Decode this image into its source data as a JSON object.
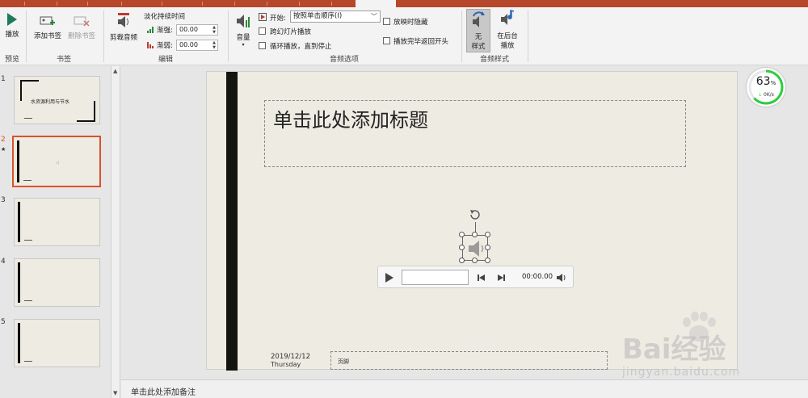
{
  "ribbon": {
    "preview": {
      "play_label": "播放",
      "group_label": "预览"
    },
    "bookmarks": {
      "add_label": "添加书签",
      "remove_label": "删除书签",
      "group_label": "书签"
    },
    "editing": {
      "trim_label": "剪裁音频",
      "fade_title": "淡化持续时间",
      "fade_in_label": "渐强:",
      "fade_in_value": "00.00",
      "fade_out_label": "渐弱:",
      "fade_out_value": "00.00",
      "group_label": "编辑"
    },
    "audio_options": {
      "volume_label": "音量",
      "start_label": "开始:",
      "start_value": "按照单击顺序(I)",
      "cross_slides_label": "跨幻灯片播放",
      "loop_label": "循环播放，直到停止",
      "hide_label": "放映时隐藏",
      "rewind_label": "播放完毕返回开头",
      "group_label": "音频选项"
    },
    "audio_styles": {
      "no_style_label_1": "无",
      "no_style_label_2": "样式",
      "bg_play_label_1": "在后台",
      "bg_play_label_2": "播放",
      "group_label": "音频样式"
    }
  },
  "slides": [
    {
      "number": "1",
      "title": "水资源利用与节水"
    },
    {
      "number": "2",
      "star": "★"
    },
    {
      "number": "3"
    },
    {
      "number": "4"
    },
    {
      "number": "5"
    }
  ],
  "slide": {
    "title_placeholder": "单击此处添加标题",
    "date": "2019/12/12",
    "weekday": "Thursday",
    "footer_placeholder": "页脚"
  },
  "player": {
    "time": "00:00.00"
  },
  "notes_placeholder": "单击此处添加备注",
  "gauge": {
    "percent": "63",
    "unit": "%",
    "speed": "0K/s",
    "progress": 0.63
  },
  "watermark": {
    "brand": "Bai经验",
    "url": "jingyan.baidu.com"
  },
  "colors": {
    "accent": "#b7472a",
    "selected_border": "#d9522c",
    "gauge_green": "#2ecc40"
  }
}
